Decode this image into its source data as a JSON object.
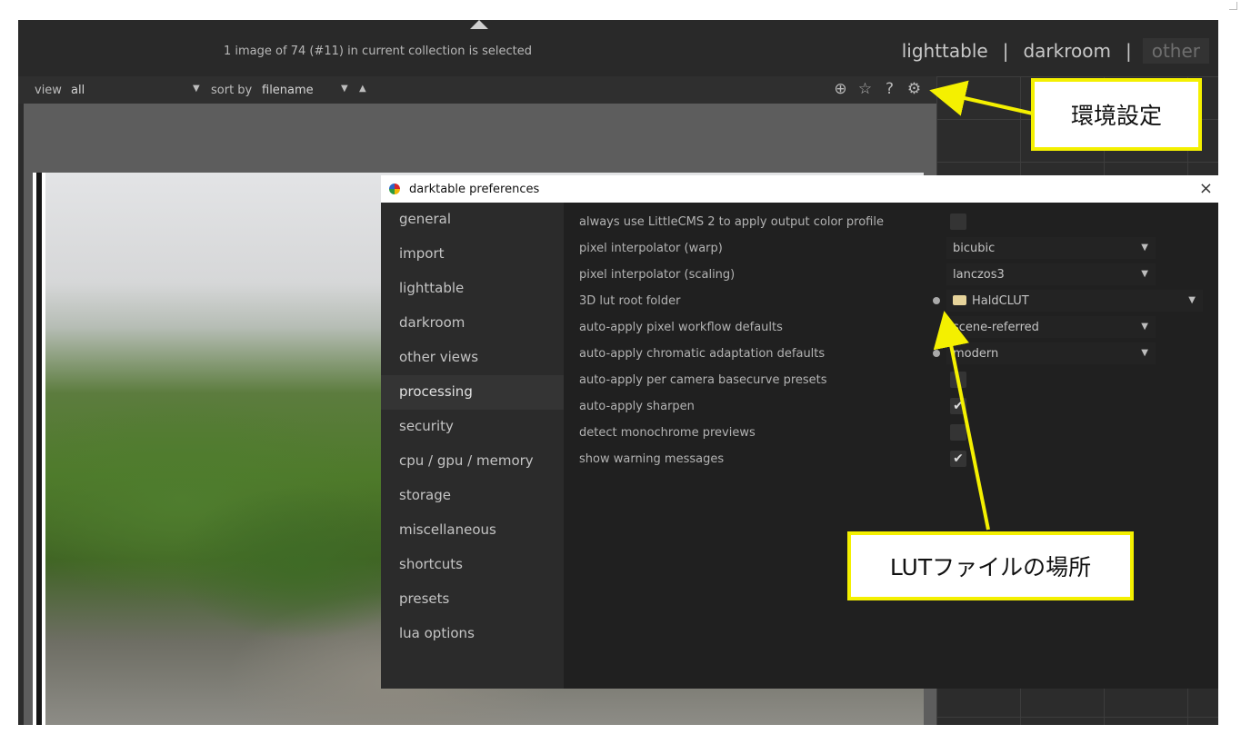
{
  "topbar": {
    "selection_info": "1 image of 74 (#11) in current collection is selected",
    "views": [
      "lighttable",
      "darkroom",
      "other"
    ],
    "separator": "|"
  },
  "filterbar": {
    "view_label": "view",
    "view_value": "all",
    "sort_label": "sort by",
    "sort_value": "filename",
    "sort_dir_icon": "▲",
    "dropdown_icon": "▼"
  },
  "top_icons": [
    "grouping-icon",
    "star-icon",
    "help-icon",
    "gear-icon"
  ],
  "top_icon_glyphs": [
    "⊕",
    "☆",
    "?",
    "⚙"
  ],
  "dialog": {
    "title": "darktable preferences",
    "close": "×",
    "nav": [
      "general",
      "import",
      "lighttable",
      "darkroom",
      "other views",
      "processing",
      "security",
      "cpu / gpu / memory",
      "storage",
      "miscellaneous",
      "shortcuts",
      "presets",
      "lua options"
    ],
    "active_nav": "processing",
    "settings": [
      {
        "label": "always use LittleCMS 2 to apply output color profile",
        "type": "checkbox",
        "checked": false
      },
      {
        "label": "pixel interpolator (warp)",
        "type": "select",
        "value": "bicubic"
      },
      {
        "label": "pixel interpolator (scaling)",
        "type": "select",
        "value": "lanczos3"
      },
      {
        "label": "3D lut root folder",
        "type": "folder",
        "value": "HaldCLUT",
        "modified": true
      },
      {
        "label": "auto-apply pixel workflow defaults",
        "type": "select",
        "value": "scene-referred"
      },
      {
        "label": "auto-apply chromatic adaptation defaults",
        "type": "select",
        "value": "modern",
        "modified": true
      },
      {
        "label": "auto-apply per camera basecurve presets",
        "type": "checkbox",
        "checked": false
      },
      {
        "label": "auto-apply sharpen",
        "type": "checkbox",
        "checked": true
      },
      {
        "label": "detect monochrome previews",
        "type": "checkbox",
        "checked": false
      },
      {
        "label": "show warning messages",
        "type": "checkbox",
        "checked": true
      }
    ],
    "checkmark": "✔"
  },
  "annotations": {
    "preferences_callout": "環境設定",
    "lut_callout": "LUTファイルの場所",
    "highlight_color": "#f4f000"
  }
}
